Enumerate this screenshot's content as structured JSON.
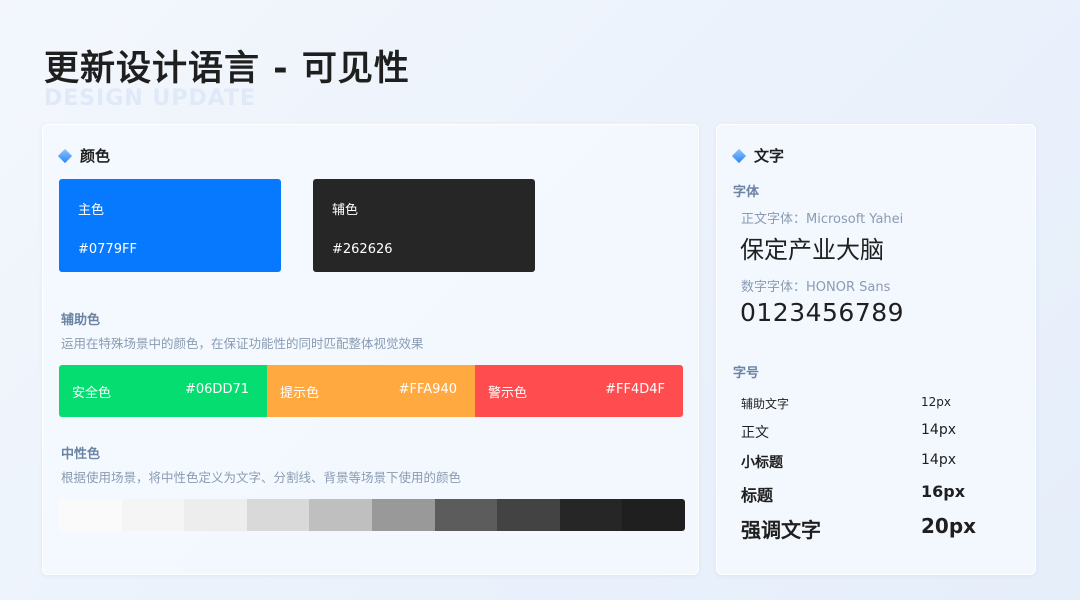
{
  "page": {
    "title": "更新设计语言 - 可见性",
    "subtitle": "DESIGN UPDATE"
  },
  "colors_card": {
    "heading": "颜色",
    "primary": {
      "name": "主色",
      "value": "#0779FF",
      "color": "#0779FF"
    },
    "secondary": {
      "name": "辅色",
      "value": "#262626",
      "color": "#262626"
    },
    "auxiliary": {
      "label": "辅助色",
      "description": "运用在特殊场景中的颜色，在保证功能性的同时匹配整体视觉效果",
      "items": [
        {
          "name": "安全色",
          "value": "#06DD71",
          "color": "#06DD71"
        },
        {
          "name": "提示色",
          "value": "#FFA940",
          "color": "#FFA940"
        },
        {
          "name": "警示色",
          "value": "#FF4D4F",
          "color": "#FF4D4F"
        }
      ]
    },
    "neutral": {
      "label": "中性色",
      "description": "根据使用场景，将中性色定义为文字、分割线、背景等场景下使用的颜色",
      "colors": [
        "#FAFAFA",
        "#F5F5F5",
        "#EDEDED",
        "#D9D9D9",
        "#BFBFBF",
        "#999999",
        "#5C5C5C",
        "#434343",
        "#262626",
        "#1F1F1F"
      ]
    }
  },
  "text_card": {
    "heading": "文字",
    "font_label": "字体",
    "body_font_name": "正文字体：Microsoft Yahei",
    "body_font_sample": "保定产业大脑",
    "number_font_name": "数字字体：HONOR Sans",
    "number_font_sample": "0123456789",
    "size_label": "字号",
    "sizes": [
      {
        "name": "辅助文字",
        "value": "12px"
      },
      {
        "name": "正文",
        "value": "14px"
      },
      {
        "name": "小标题",
        "value": "14px"
      },
      {
        "name": "标题",
        "value": "16px"
      },
      {
        "name": "强调文字",
        "value": "20px"
      }
    ]
  }
}
